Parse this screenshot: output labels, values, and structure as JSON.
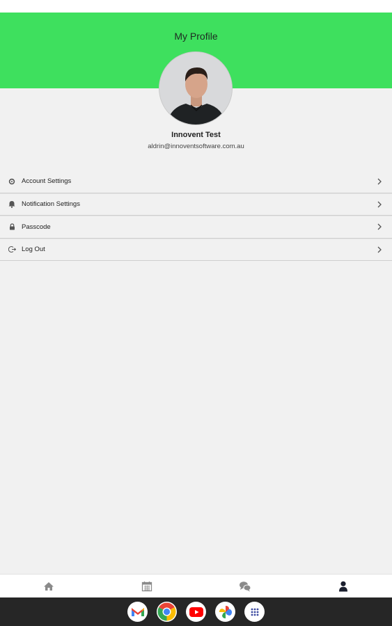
{
  "header": {
    "title": "My Profile",
    "bg_color": "#3ee05e"
  },
  "profile": {
    "name": "Innovent Test",
    "email": "aldrin@innoventsoftware.com.au",
    "avatar_icon": "profile-photo"
  },
  "menu": {
    "items": [
      {
        "label": "Account Settings",
        "icon": "gear-icon"
      },
      {
        "label": "Notification Settings",
        "icon": "bell-icon"
      },
      {
        "label": "Passcode",
        "icon": "lock-icon"
      },
      {
        "label": "Log Out",
        "icon": "logout-icon"
      }
    ],
    "chevron_icon": "chevron-right-icon"
  },
  "bottom_nav": {
    "items": [
      {
        "icon": "home-icon",
        "active": false
      },
      {
        "icon": "calendar-icon",
        "active": false
      },
      {
        "icon": "chat-icon",
        "active": false
      },
      {
        "icon": "user-icon",
        "active": true
      }
    ],
    "active_color": "#1b1f2e",
    "inactive_color": "#8a8a8a"
  },
  "taskbar": {
    "apps": [
      "gmail-icon",
      "chrome-icon",
      "youtube-icon",
      "photos-icon",
      "app-launcher-icon"
    ]
  }
}
